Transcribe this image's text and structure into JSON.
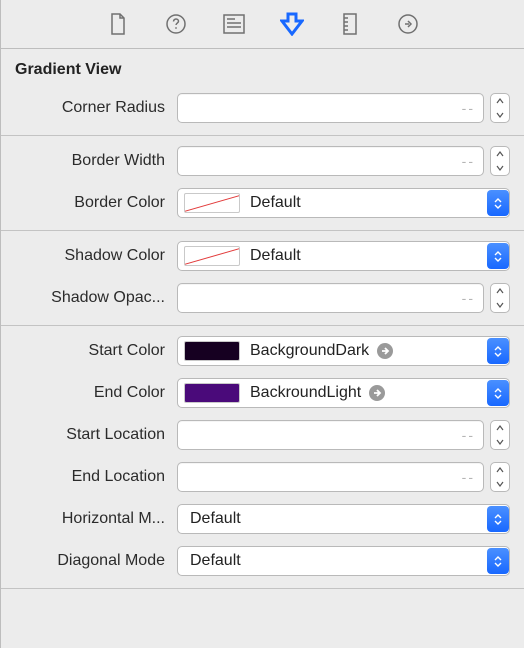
{
  "tabs": [
    "file",
    "help",
    "identity",
    "attributes",
    "size",
    "connections"
  ],
  "active_tab_index": 3,
  "header": {
    "title": "Gradient View"
  },
  "rows": {
    "corner_radius": {
      "label": "Corner Radius",
      "value": "",
      "placeholder": "--"
    },
    "border_width": {
      "label": "Border Width",
      "value": "",
      "placeholder": "--"
    },
    "border_color": {
      "label": "Border Color",
      "color_name": "Default",
      "swatch": "none"
    },
    "shadow_color": {
      "label": "Shadow Color",
      "color_name": "Default",
      "swatch": "none"
    },
    "shadow_opacity": {
      "label": "Shadow Opac...",
      "value": "",
      "placeholder": "--"
    },
    "start_color": {
      "label": "Start Color",
      "color_name": "BackgroundDark",
      "swatch_hex": "#160021",
      "has_jump": true
    },
    "end_color": {
      "label": "End Color",
      "color_name": "BackroundLight",
      "swatch_hex": "#4a0a7a",
      "has_jump": true
    },
    "start_location": {
      "label": "Start Location",
      "value": "",
      "placeholder": "--"
    },
    "end_location": {
      "label": "End Location",
      "value": "",
      "placeholder": "--"
    },
    "horizontal_mode": {
      "label": "Horizontal M...",
      "value": "Default"
    },
    "diagonal_mode": {
      "label": "Diagonal Mode",
      "value": "Default"
    }
  },
  "colors": {
    "accent": "#2f74ff"
  }
}
